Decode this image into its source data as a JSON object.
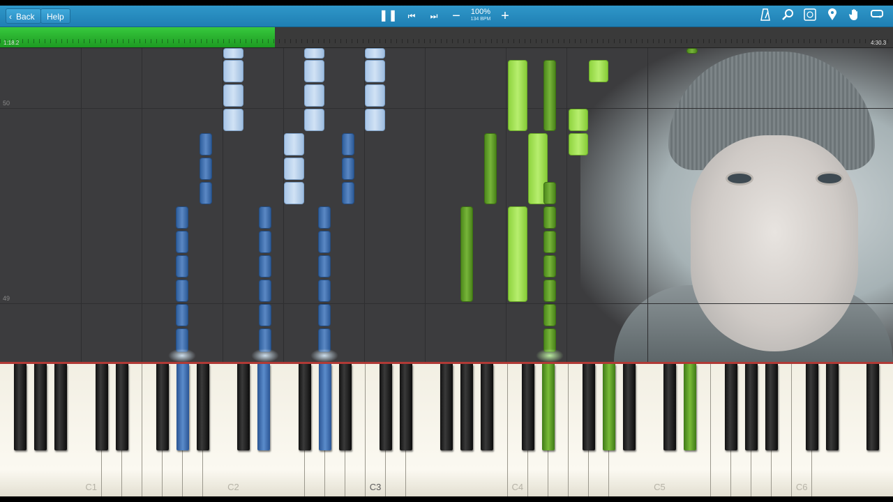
{
  "toolbar": {
    "back_label": "Back",
    "help_label": "Help",
    "zoom_percent": "100%",
    "tempo": "134 BPM",
    "icons": [
      "pause-icon",
      "previous-icon",
      "next-icon",
      "minus-icon",
      "plus-icon",
      "metronome-icon",
      "search-icon",
      "note-labels-icon",
      "marker-icon",
      "hand-icon",
      "loop-icon"
    ],
    "accent": "#2a8cc1"
  },
  "progress": {
    "elapsed": "1:18.2",
    "total": "4:30.3",
    "fraction": 0.289,
    "fill_color": "#2aae2f"
  },
  "roll": {
    "measures": [
      "50",
      "49"
    ]
  },
  "keyboard": {
    "octave_labels": [
      "C1",
      "C2",
      "C3",
      "C4",
      "C5",
      "C6"
    ],
    "active_hand_colors": {
      "left": "#4a7dbd",
      "right": "#6fb336"
    }
  }
}
